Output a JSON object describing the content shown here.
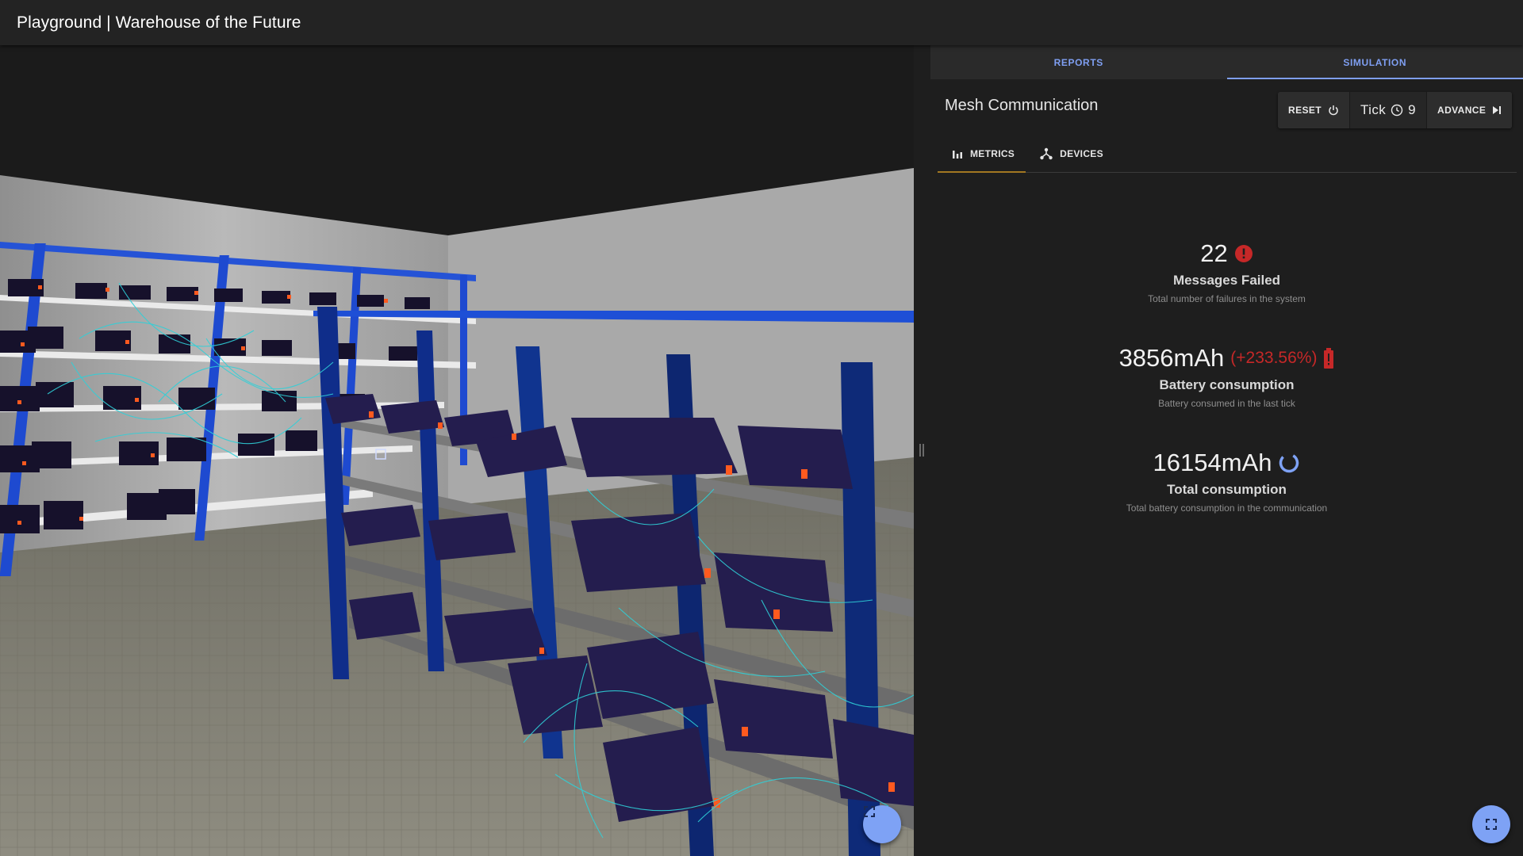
{
  "app": {
    "title": "Playground | Warehouse of the Future"
  },
  "panel": {
    "tabs": [
      {
        "label": "REPORTS",
        "active": false
      },
      {
        "label": "SIMULATION",
        "active": true
      }
    ],
    "simulation": {
      "title": "Mesh Communication",
      "reset_label": "RESET",
      "tick_label": "Tick",
      "tick_value": "9",
      "advance_label": "ADVANCE"
    },
    "subtabs": [
      {
        "label": "METRICS",
        "icon": "bar-chart-icon",
        "active": true
      },
      {
        "label": "DEVICES",
        "icon": "network-icon",
        "active": false
      }
    ],
    "metrics": [
      {
        "value": "22",
        "delta": "",
        "label": "Messages Failed",
        "desc": "Total number of failures in the system",
        "icon": "error-icon"
      },
      {
        "value": "3856mAh",
        "delta": "(+233.56%)",
        "label": "Battery consumption",
        "desc": "Battery consumed in the last tick",
        "icon": "battery-alert-icon"
      },
      {
        "value": "16154mAh",
        "delta": "",
        "label": "Total consumption",
        "desc": "Total battery consumption in the communication",
        "icon": "loading-spinner-icon"
      }
    ]
  },
  "colors": {
    "accent": "#7f9ff2",
    "subtab_indicator": "#a37822",
    "error": "#c62828",
    "rack_blue": "#1a4fd1",
    "mesh_line": "#2fd0d8"
  },
  "fullscreen_icons": [
    "fullscreen-icon",
    "fullscreen-icon"
  ]
}
